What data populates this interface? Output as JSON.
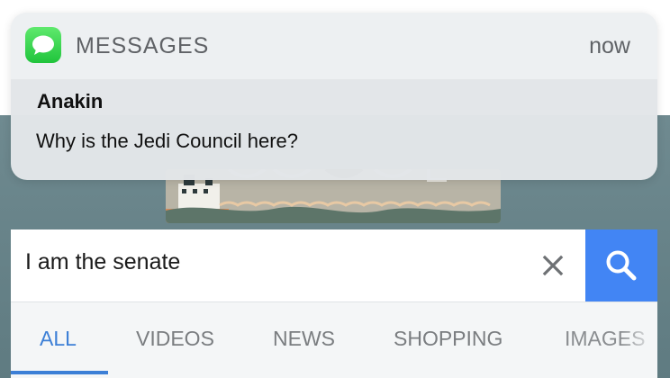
{
  "notification": {
    "app_name": "MESSAGES",
    "time": "now",
    "sender": "Anakin",
    "message": "Why is the Jedi Council here?",
    "app_icon": "messages-bubble-icon"
  },
  "search": {
    "query": "I am the senate",
    "clear_icon": "close-icon",
    "search_icon": "search-icon",
    "accent_color": "#4285f4"
  },
  "tabs": {
    "items": [
      {
        "label": "ALL",
        "active": true
      },
      {
        "label": "VIDEOS",
        "active": false
      },
      {
        "label": "NEWS",
        "active": false
      },
      {
        "label": "SHOPPING",
        "active": false
      },
      {
        "label": "IMAGES",
        "active": false
      }
    ],
    "active_color": "#3c7fd6"
  }
}
